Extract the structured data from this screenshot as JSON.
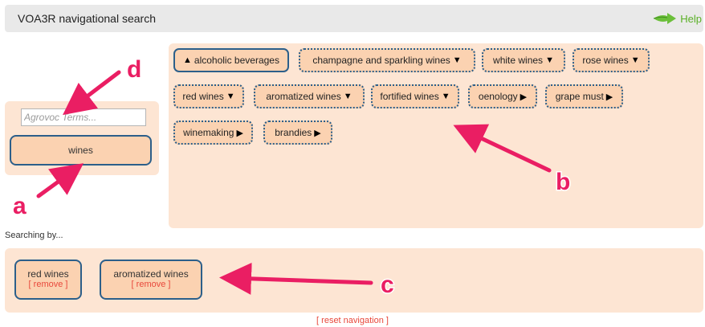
{
  "header": {
    "title": "VOA3R navigational search",
    "help_label": "Help",
    "help_icon": "green-arrow-icon"
  },
  "search": {
    "placeholder": "Agrovoc Terms...",
    "value": "",
    "selected_term": "wines"
  },
  "related_terms": [
    {
      "label": "alcoholic beverages",
      "arrow": "▲",
      "arrow_pos": "before",
      "border": "solid"
    },
    {
      "label": "champagne and sparkling wines",
      "arrow": "▼",
      "arrow_pos": "after",
      "border": "dotted"
    },
    {
      "label": "white wines",
      "arrow": "▼",
      "arrow_pos": "after",
      "border": "dotted"
    },
    {
      "label": "rose wines",
      "arrow": "▼",
      "arrow_pos": "after",
      "border": "dotted"
    },
    {
      "label": "red wines",
      "arrow": "▼",
      "arrow_pos": "after",
      "border": "dotted"
    },
    {
      "label": "aromatized wines",
      "arrow": "▼",
      "arrow_pos": "after",
      "border": "dotted"
    },
    {
      "label": "fortified wines",
      "arrow": "▼",
      "arrow_pos": "after",
      "border": "dotted"
    },
    {
      "label": "oenology",
      "arrow": "▶",
      "arrow_pos": "after",
      "border": "dotted"
    },
    {
      "label": "grape must",
      "arrow": "▶",
      "arrow_pos": "after",
      "border": "dotted"
    },
    {
      "label": "winemaking",
      "arrow": "▶",
      "arrow_pos": "after",
      "border": "dotted"
    },
    {
      "label": "brandies",
      "arrow": "▶",
      "arrow_pos": "after",
      "border": "dotted"
    }
  ],
  "searching": {
    "label": "Searching by...",
    "terms": [
      {
        "label": "red wines",
        "remove": "[ remove ]"
      },
      {
        "label": "aromatized wines",
        "remove": "[ remove ]"
      }
    ],
    "reset": "[ reset navigation ]"
  },
  "annotations": {
    "a": "a",
    "b": "b",
    "c": "c",
    "d": "d",
    "color": "#ea1e63"
  }
}
